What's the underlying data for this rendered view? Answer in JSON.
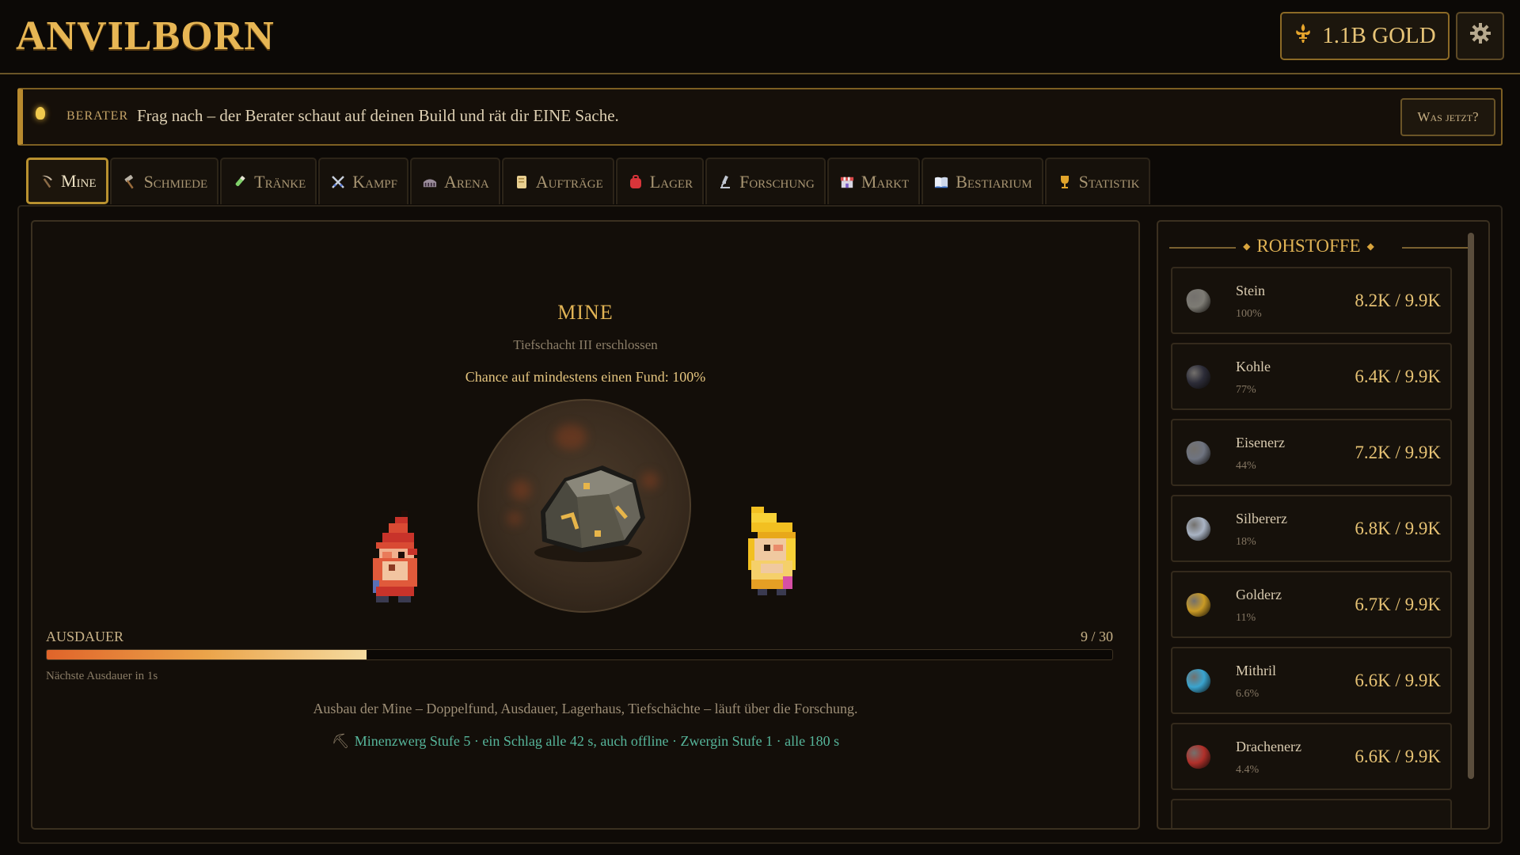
{
  "app": {
    "title": "ANVILBORN"
  },
  "header": {
    "gold_label": "1.1B GOLD",
    "gold_icon": "fleur-de-lis-icon",
    "settings_icon": "gear-icon"
  },
  "advisor": {
    "tag": "BERATER",
    "message": "Frag nach – der Berater schaut auf deinen Build und rät dir EINE Sache.",
    "button": "Was jetzt?"
  },
  "tabs": [
    {
      "label": "Mine",
      "icon": "pickaxe-icon",
      "active": true
    },
    {
      "label": "Schmiede",
      "icon": "hammer-icon"
    },
    {
      "label": "Tränke",
      "icon": "potion-icon"
    },
    {
      "label": "Kampf",
      "icon": "crossed-swords-icon"
    },
    {
      "label": "Arena",
      "icon": "arena-icon"
    },
    {
      "label": "Aufträge",
      "icon": "scroll-icon"
    },
    {
      "label": "Lager",
      "icon": "backpack-icon"
    },
    {
      "label": "Forschung",
      "icon": "microscope-icon"
    },
    {
      "label": "Markt",
      "icon": "market-icon"
    },
    {
      "label": "Bestiarium",
      "icon": "book-icon"
    },
    {
      "label": "Statistik",
      "icon": "trophy-icon"
    }
  ],
  "mine": {
    "title": "MINE",
    "subtitle": "Tiefschacht III erschlossen",
    "chance": "Chance auf mindestens einen Fund: 100%",
    "stamina_label": "AUSDAUER",
    "stamina_value": "9 / 30",
    "stamina_fraction": 0.3,
    "stamina_next": "Nächste Ausdauer in 1s",
    "note": "Ausbau der Mine – Doppelfund, Ausdauer, Lagerhaus, Tiefschächte – läuft über die Forschung.",
    "dwarf_line": "Minenzwerg Stufe 5 · ein Schlag alle 42 s, auch offline · Zwergin Stufe 1 · alle 180 s"
  },
  "resources": {
    "title": "ROHSTOFFE",
    "items": [
      {
        "name": "Stein",
        "pct": "100%",
        "amount": "8.2K / 9.9K",
        "color": "#7d7b74"
      },
      {
        "name": "Kohle",
        "pct": "77%",
        "amount": "6.4K / 9.9K",
        "color": "#2c2c38"
      },
      {
        "name": "Eisenerz",
        "pct": "44%",
        "amount": "7.2K / 9.9K",
        "color": "#6f7480"
      },
      {
        "name": "Silbererz",
        "pct": "18%",
        "amount": "6.8K / 9.9K",
        "color": "#a9b4c4"
      },
      {
        "name": "Golderz",
        "pct": "11%",
        "amount": "6.7K / 9.9K",
        "color": "#c99a25"
      },
      {
        "name": "Mithril",
        "pct": "6.6%",
        "amount": "6.6K / 9.9K",
        "color": "#3aa4cf"
      },
      {
        "name": "Drachenerz",
        "pct": "4.4%",
        "amount": "6.6K / 9.9K",
        "color": "#b0302a"
      }
    ]
  }
}
